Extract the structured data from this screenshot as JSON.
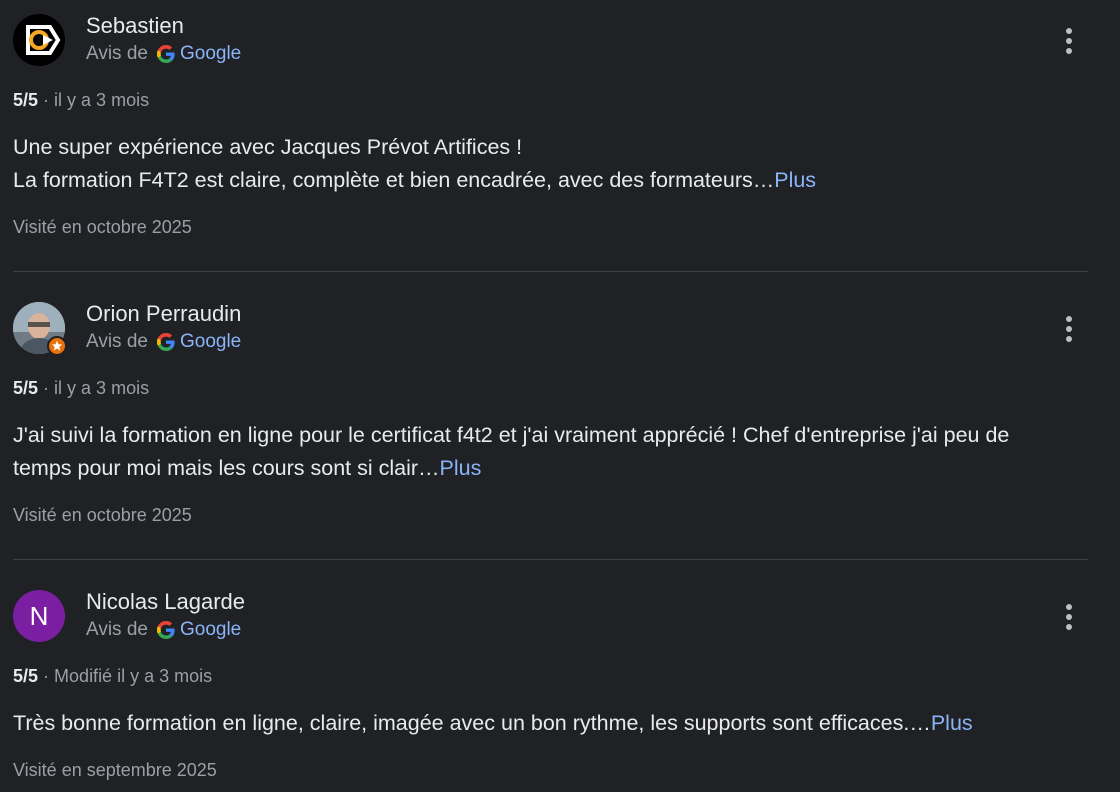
{
  "source_prefix": "Avis de",
  "source_name": "Google",
  "more_label": "Plus",
  "reviews": [
    {
      "author": "Sebastien",
      "avatar_type": "logo",
      "rating": "5/5",
      "time": "il y a 3 mois",
      "text_lines": [
        "Une super expérience avec Jacques Prévot Artifices !",
        "La formation F4T2 est claire, complète et bien encadrée, avec des formateurs…"
      ],
      "visited": "Visité en octobre 2025"
    },
    {
      "author": "Orion Perraudin",
      "avatar_type": "photo",
      "local_guide": true,
      "rating": "5/5",
      "time": "il y a 3 mois",
      "text_lines": [
        "J'ai suivi la formation en ligne pour le certificat f4t2 et j'ai vraiment apprécié ! Chef d'entreprise j'ai peu de",
        "temps pour moi mais les cours sont si clair…"
      ],
      "visited": "Visité en octobre 2025"
    },
    {
      "author": "Nicolas Lagarde",
      "avatar_type": "letter",
      "avatar_letter": "N",
      "avatar_color": "#7b1fa2",
      "rating": "5/5",
      "time": "Modifié il y a 3 mois",
      "text_lines": [
        "Très bonne formation en ligne, claire, imagée avec un bon rythme, les supports sont efficaces.…"
      ],
      "visited": "Visité en septembre 2025"
    }
  ]
}
